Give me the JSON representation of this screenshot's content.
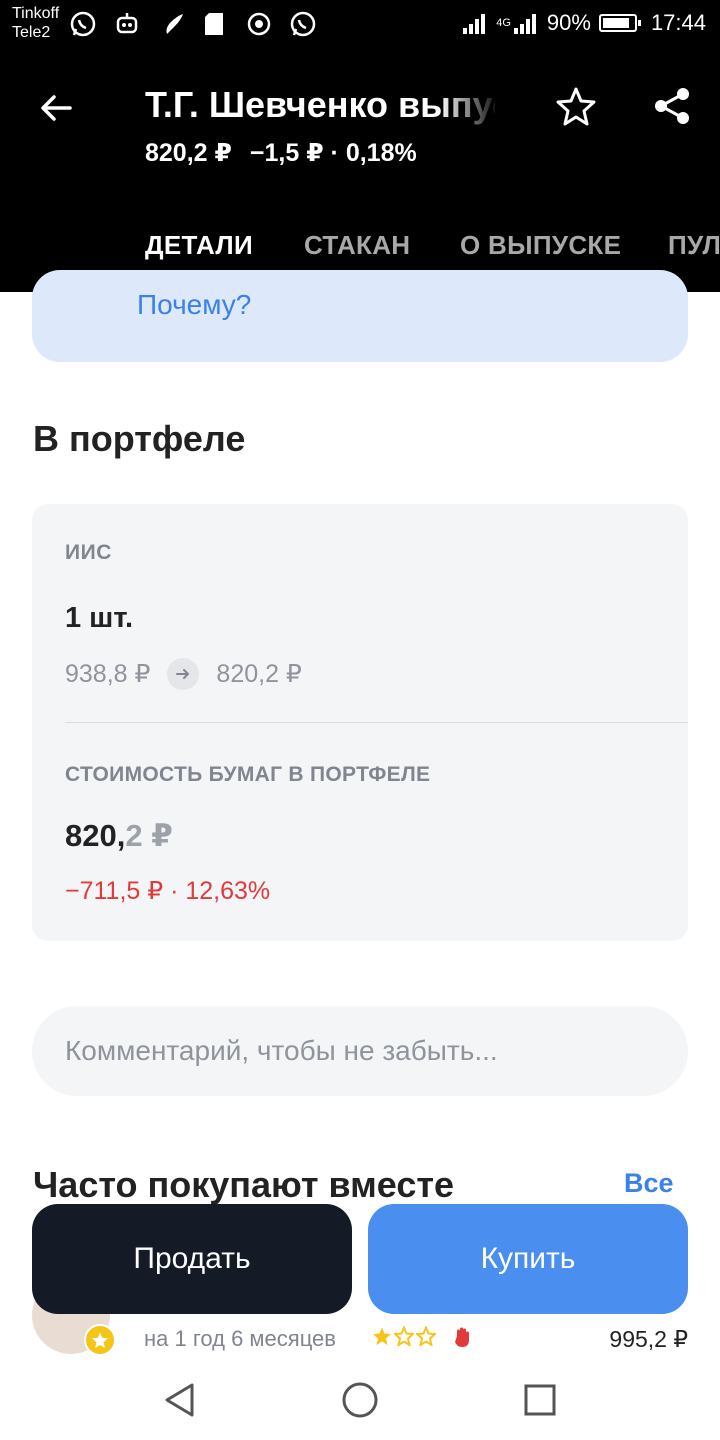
{
  "status_bar": {
    "carrier_1": "Tinkoff",
    "carrier_2": "Tele2",
    "network": "4G",
    "battery": "90%",
    "time": "17:44"
  },
  "header": {
    "title": "Т.Г. Шевченко выпуск",
    "price": "820,2 ₽",
    "change": "−1,5 ₽ · 0,18%"
  },
  "tabs": [
    "ДЕТАЛИ",
    "СТАКАН",
    "О ВЫПУСКЕ",
    "ПУЛЬС"
  ],
  "active_tab": "ДЕТАЛИ",
  "info_card": {
    "link_text": "Почему?"
  },
  "portfolio": {
    "title": "В портфеле",
    "account": "ИИС",
    "quantity": "1 шт.",
    "buy_price": "938,8 ₽",
    "current_price": "820,2 ₽",
    "value_label": "СТОИМОСТЬ БУМАГ В ПОРТФЕЛЕ",
    "value_main": "820,",
    "value_fraction": "2 ₽",
    "value_change": "−711,5 ₽ · 12,63%"
  },
  "comment": {
    "placeholder": "Комментарий, чтобы не забыть..."
  },
  "recommendations": {
    "title": "Часто покупают вместе",
    "all_link": "Все",
    "item": {
      "subtitle": "на 1 год 6 месяцев",
      "price": "995,2 ₽",
      "rating_filled": 1,
      "rating_total": 3
    }
  },
  "actions": {
    "sell": "Продать",
    "buy": "Купить"
  },
  "colors": {
    "accent_blue": "#4a8ef0",
    "link_blue": "#3b82e6",
    "negative_red": "#e23a3a",
    "dark_button": "#141b27"
  }
}
